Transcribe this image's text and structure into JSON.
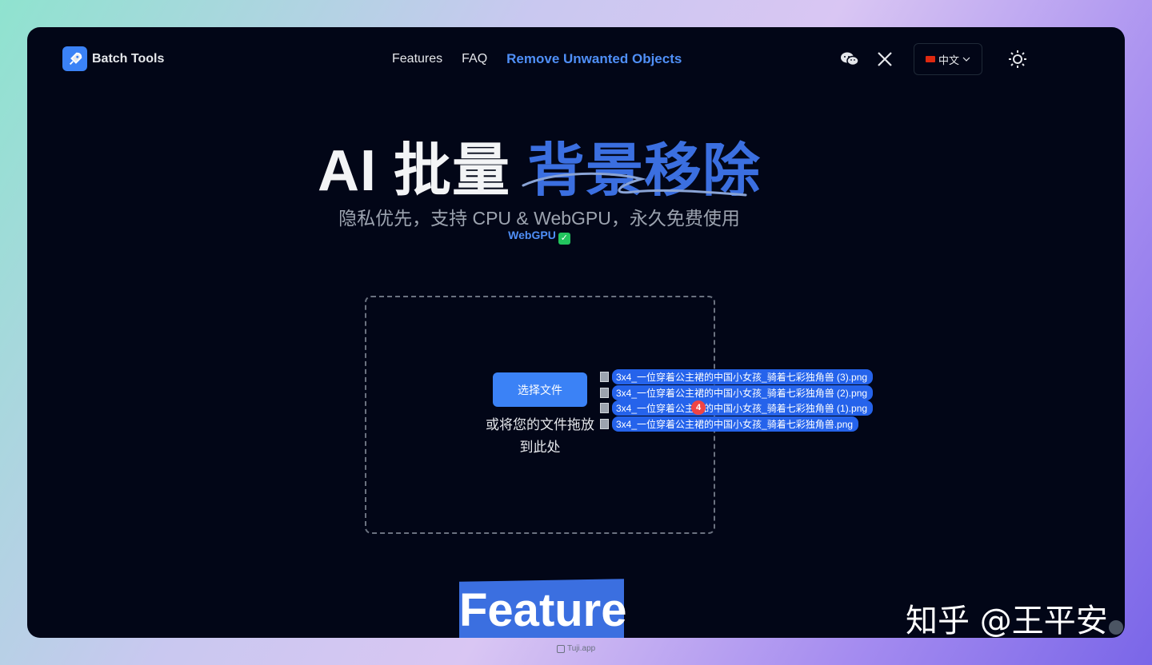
{
  "header": {
    "brand": "Batch Tools",
    "nav": [
      {
        "label": "Features"
      },
      {
        "label": "FAQ"
      },
      {
        "label": "Remove Unwanted Objects"
      }
    ],
    "language": "中文"
  },
  "hero": {
    "title_prefix": "AI 批量 ",
    "title_accent": "背景移除",
    "subtitle": "隐私优先，支持 CPU & WebGPU，永久免费使用",
    "webgpu": "WebGPU"
  },
  "upload": {
    "button_label": "选择文件",
    "hint": "或将您的文件拖放到此处",
    "dragging_count": "4",
    "dragging_files": [
      "3x4_一位穿着公主裙的中国小女孩_骑着七彩独角兽 (3).png",
      "3x4_一位穿着公主裙的中国小女孩_骑着七彩独角兽 (2).png",
      "3x4_一位穿着公主裙的中国小女孩_骑着七彩独角兽 (1).png",
      "3x4_一位穿着公主裙的中国小女孩_骑着七彩独角兽.png"
    ]
  },
  "section": {
    "feature_title": "Feature"
  },
  "overlay": {
    "watermark": "知乎 @王平安",
    "footer_tag": "Tuji.app"
  },
  "colors": {
    "accent": "#3b82f6",
    "background": "#020617"
  }
}
